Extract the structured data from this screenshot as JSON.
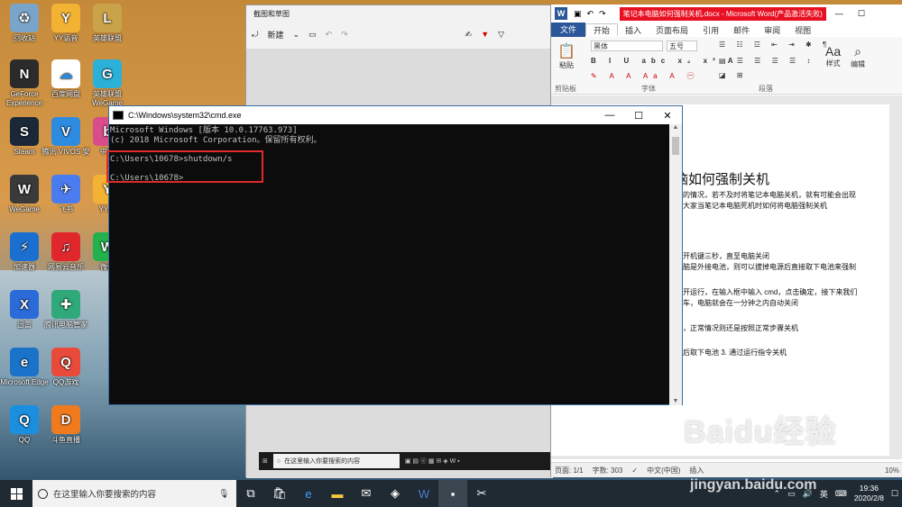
{
  "desktop_icons": [
    {
      "label": "回收站",
      "icon": "recycle-bin-icon",
      "color": "#7aa4c8",
      "glyph": "♻"
    },
    {
      "label": "YY语音",
      "icon": "yy-icon",
      "color": "#f2b233",
      "glyph": "Y"
    },
    {
      "label": "英雄联盟",
      "icon": "lol-icon",
      "color": "#c9a24a",
      "glyph": "L"
    },
    {
      "label": "GeForce Experience",
      "icon": "geforce-icon",
      "color": "#2b2b2b",
      "glyph": "N"
    },
    {
      "label": "百度网盘",
      "icon": "baidu-pan-icon",
      "color": "#ffffff",
      "glyph": "☁"
    },
    {
      "label": "英雄联盟WeGame",
      "icon": "wegame-icon",
      "color": "#2bb0d8",
      "glyph": "G"
    },
    {
      "label": "Steam",
      "icon": "steam-icon",
      "color": "#1b2838",
      "glyph": "S"
    },
    {
      "label": "腾讯 VIVOS 安",
      "icon": "vivos-icon",
      "color": "#2d8be0",
      "glyph": "V"
    },
    {
      "label": "中华",
      "icon": "bilibili-icon",
      "color": "#d94c8a",
      "glyph": "b"
    },
    {
      "label": "WeGame",
      "icon": "wegame2-icon",
      "color": "#3a3a3a",
      "glyph": "W"
    },
    {
      "label": "飞书",
      "icon": "feishu-icon",
      "color": "#4a7cf0",
      "glyph": "✈"
    },
    {
      "label": "YY游",
      "icon": "yy2-icon",
      "color": "#f2b233",
      "glyph": "Y"
    },
    {
      "label": "加速器",
      "icon": "accelerator-icon",
      "color": "#1a6fd0",
      "glyph": "⚡"
    },
    {
      "label": "网易云音乐",
      "icon": "netease-music-icon",
      "color": "#e0282c",
      "glyph": "♫"
    },
    {
      "label": "微信",
      "icon": "wechat-icon",
      "color": "#22b14c",
      "glyph": "W"
    },
    {
      "label": "迅雷",
      "icon": "xunlei-icon",
      "color": "#2b6bd8",
      "glyph": "X"
    },
    {
      "label": "腾讯电脑管家",
      "icon": "tencent-manager-icon",
      "color": "#2fa87a",
      "glyph": "✚"
    },
    {
      "label": "Microsoft Edge",
      "icon": "edge-icon",
      "color": "#1a73c8",
      "glyph": "e"
    },
    {
      "label": "QQ游戏",
      "icon": "qq-game-icon",
      "color": "#e84b3a",
      "glyph": "Q"
    },
    {
      "label": "QQ",
      "icon": "qq-icon",
      "color": "#1a8fe0",
      "glyph": "Q"
    },
    {
      "label": "斗鱼直播",
      "icon": "douyu-icon",
      "color": "#f07a1e",
      "glyph": "D"
    }
  ],
  "snip_window": {
    "title": "截图和草图",
    "new_label": "新建",
    "search_placeholder": "在这里输入你要搜索的内容"
  },
  "cmd_window": {
    "title": "C:\\Windows\\system32\\cmd.exe",
    "lines": [
      "Microsoft Windows [版本 10.0.17763.973]",
      "(c) 2018 Microsoft Corporation。保留所有权利。",
      "",
      "C:\\Users\\10678>shutdown/s",
      "",
      "C:\\Users\\10678>"
    ]
  },
  "word_window": {
    "title": "笔记本电脑如何强制关机.docx - Microsoft Word(产品激活失败)",
    "tabs": [
      "文件",
      "开始",
      "插入",
      "页面布局",
      "引用",
      "邮件",
      "审阅",
      "视图"
    ],
    "active_tab": "开始",
    "font_name": "黑体",
    "font_size": "五号",
    "paste_label": "粘贴",
    "style_label": "样式",
    "edit_label": "编辑",
    "group_clipboard": "剪贴板",
    "group_font": "字体",
    "group_paragraph": "段落",
    "doc_heading": "电脑如何强制关机",
    "doc_lines": [
      "机的情况，若不及时将笔记本电脑关机，就有可能会出现",
      "数大家当笔记本电脑死机时如何将电脑强制关机",
      "的开机键三秒，直至电脑关闭",
      "电脑是外接电池，则可以拔掉电源后直接取下电池来强制",
      "打开运行，在输入框中输入 cmd，点击确定，接下来我们",
      "回车，电脑就会在一分钟之内自动关闭",
      "况，正常情况则还是按照正常步骤关机",
      "源后取下电池 3. 通过运行指令关机"
    ],
    "status_page": "页面: 1/1",
    "status_words": "字数: 303",
    "status_lang": "中文(中国)",
    "status_mode": "插入",
    "zoom": "10%"
  },
  "taskbar": {
    "search_placeholder": "在这里输入你要搜索的内容",
    "ime": "英",
    "time": "19:36",
    "date": "2020/2/8"
  },
  "watermark": {
    "brand": "Baidu经验",
    "url": "jingyan.baidu.com"
  }
}
